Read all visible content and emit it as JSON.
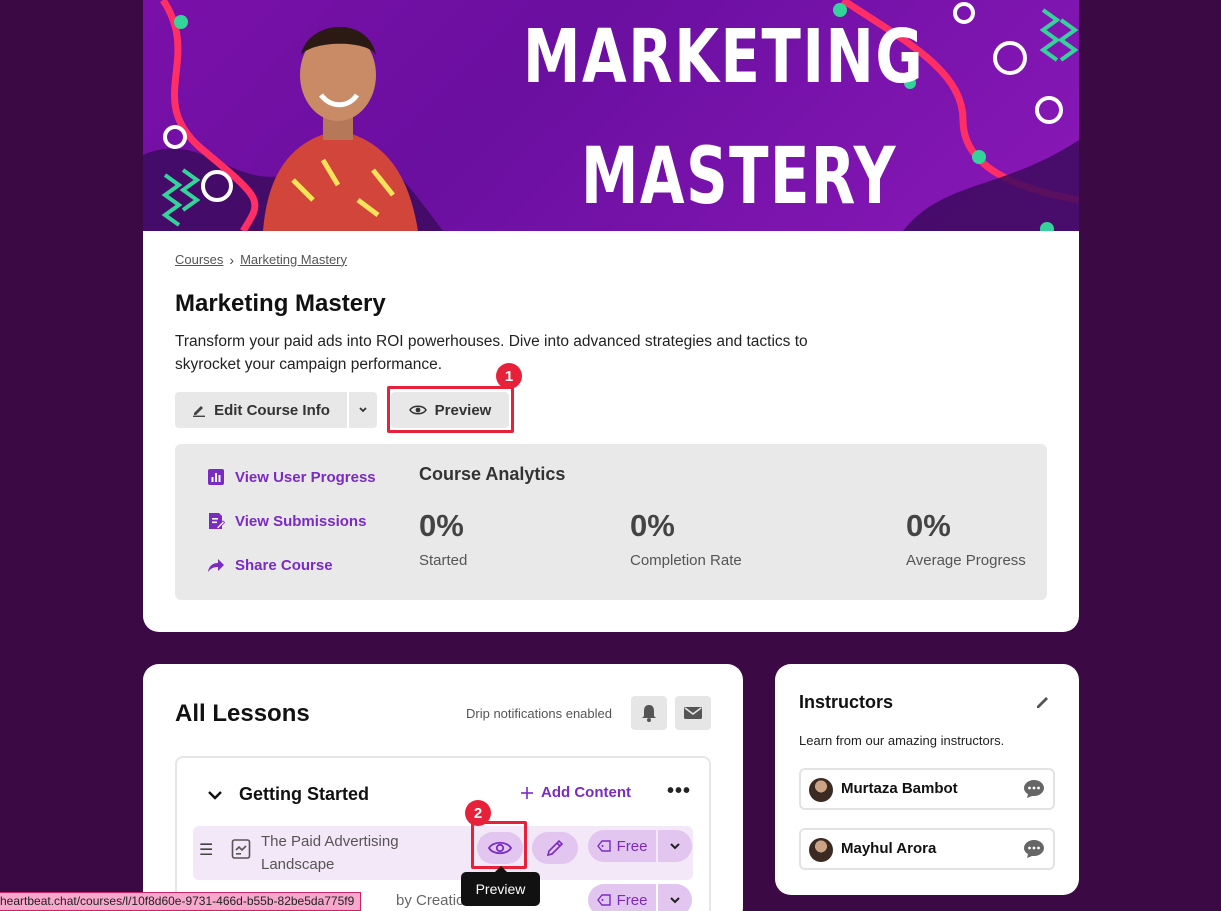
{
  "banner": {
    "line1": "MARKETING",
    "line2": "MASTERY"
  },
  "breadcrumb": {
    "items": [
      "Courses",
      "Marketing Mastery"
    ]
  },
  "course": {
    "title": "Marketing Mastery",
    "description": "Transform your paid ads into ROI powerhouses. Dive into advanced strategies and tactics to skyrocket your campaign performance."
  },
  "actions": {
    "edit_label": "Edit Course Info",
    "preview_label": "Preview"
  },
  "annotations": {
    "step1": "1",
    "step2": "2"
  },
  "analytics": {
    "links": [
      "View User Progress",
      "View Submissions",
      "Share Course"
    ],
    "title": "Course Analytics",
    "stats": [
      {
        "value": "0%",
        "label": "Started"
      },
      {
        "value": "0%",
        "label": "Completion Rate"
      },
      {
        "value": "0%",
        "label": "Average Progress"
      }
    ]
  },
  "lessons": {
    "title": "All Lessons",
    "drip_text": "Drip notifications enabled",
    "section_title": "Getting Started",
    "add_content_label": "Add Content",
    "lesson1_name": "The Paid Advertising Landscape",
    "lesson2_fragment": "by Creation",
    "free_label": "Free",
    "tooltip": "Preview"
  },
  "status_url": "heartbeat.chat/courses/l/10f8d60e-9731-466d-b55b-82be5da775f9",
  "instructors": {
    "title": "Instructors",
    "subtitle": "Learn from our amazing instructors.",
    "items": [
      {
        "name": "Murtaza Bambot"
      },
      {
        "name": "Mayhul Arora"
      }
    ]
  },
  "colors": {
    "page_bg": "#3b0a45",
    "accent": "#7a2bc2",
    "highlight": "#e8213a",
    "pill_bg": "#e2c6ef"
  },
  "icons": [
    "pencil-icon",
    "chevron-down-icon",
    "eye-icon",
    "bar-chart-icon",
    "submissions-icon",
    "share-icon",
    "bell-icon",
    "mail-icon",
    "plus-icon",
    "more-icon",
    "drag-handle-icon",
    "lesson-doc-icon",
    "tag-icon",
    "chat-icon"
  ]
}
